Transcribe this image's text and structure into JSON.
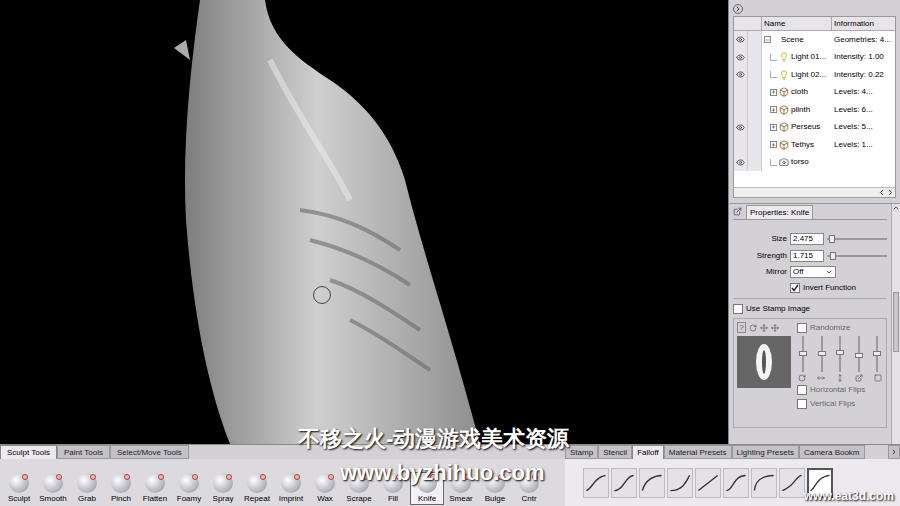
{
  "watermarks": {
    "site_title": "不移之火-动漫游戏美术资源",
    "site_url": "www.byzhihuo.com",
    "source": "www.eat3d.com"
  },
  "viewport": {
    "brush_cursor": true
  },
  "outliner": {
    "columns": [
      "Name",
      "Information"
    ],
    "rows": [
      {
        "name": "Scene",
        "info": "Geometries: 4...",
        "depth": 0,
        "kind": "scene",
        "expandable": true,
        "expanded": true,
        "visible": true,
        "locked": false
      },
      {
        "name": "Light 01...",
        "info": "Intensity: 1.00",
        "depth": 1,
        "kind": "light",
        "expandable": false,
        "expanded": false,
        "visible": true,
        "locked": false
      },
      {
        "name": "Light 02...",
        "info": "Intensity: 0.22",
        "depth": 1,
        "kind": "light",
        "expandable": false,
        "expanded": false,
        "visible": true,
        "locked": false
      },
      {
        "name": "cloth",
        "info": "Levels: 4...",
        "depth": 1,
        "kind": "mesh",
        "expandable": true,
        "expanded": false,
        "visible": false,
        "locked": false
      },
      {
        "name": "plinth",
        "info": "Levels: 6...",
        "depth": 1,
        "kind": "mesh",
        "expandable": true,
        "expanded": false,
        "visible": false,
        "locked": false
      },
      {
        "name": "Perseus",
        "info": "Levels: 5...",
        "depth": 1,
        "kind": "mesh",
        "expandable": true,
        "expanded": false,
        "visible": true,
        "locked": false
      },
      {
        "name": "Tethys",
        "info": "Levels: 1...",
        "depth": 1,
        "kind": "mesh",
        "expandable": true,
        "expanded": false,
        "visible": false,
        "locked": false
      },
      {
        "name": "torso",
        "info": "",
        "depth": 1,
        "kind": "camera",
        "expandable": false,
        "expanded": false,
        "visible": true,
        "locked": false
      }
    ]
  },
  "properties": {
    "title": "Properties: Knife",
    "fields": [
      {
        "label": "Size",
        "value": "2.475",
        "level": 0.03
      },
      {
        "label": "Strength",
        "value": "1.715",
        "level": 0.05
      }
    ],
    "mirror": {
      "label": "Mirror",
      "value": "Off"
    },
    "invert": {
      "label": "Invert Function",
      "checked": true
    },
    "use_stamp": {
      "label": "Use Stamp Image",
      "checked": false
    },
    "stamp": {
      "help": "?",
      "randomize": {
        "label": "Randomize",
        "checked": false
      },
      "sliders": [
        {
          "level": 0.5
        },
        {
          "level": 0.5
        },
        {
          "level": 0.55
        },
        {
          "level": 0.45
        },
        {
          "level": 0.5
        }
      ],
      "horizontal": {
        "label": "Horizontal Flips",
        "checked": false
      },
      "vertical": {
        "label": "Vertical Flips",
        "checked": false
      }
    }
  },
  "tool_tabs": [
    {
      "label": "Sculpt Tools",
      "selected": true
    },
    {
      "label": "Paint Tools",
      "selected": false
    },
    {
      "label": "Select/Move Tools",
      "selected": false
    }
  ],
  "tools": [
    {
      "label": "Sculpt",
      "selected": false
    },
    {
      "label": "Smooth",
      "selected": false
    },
    {
      "label": "Grab",
      "selected": false
    },
    {
      "label": "Pinch",
      "selected": false
    },
    {
      "label": "Flatten",
      "selected": false
    },
    {
      "label": "Foamy",
      "selected": false
    },
    {
      "label": "Spray",
      "selected": false
    },
    {
      "label": "Repeat",
      "selected": false
    },
    {
      "label": "Imprint",
      "selected": false
    },
    {
      "label": "Wax",
      "selected": false
    },
    {
      "label": "Scrape",
      "selected": false
    },
    {
      "label": "Fill",
      "selected": false
    },
    {
      "label": "Knife",
      "selected": true
    },
    {
      "label": "Smear",
      "selected": false
    },
    {
      "label": "Bulge",
      "selected": false
    },
    {
      "label": "Cntr",
      "selected": false
    }
  ],
  "tray_tabs": [
    {
      "label": "Stamp",
      "selected": false
    },
    {
      "label": "Stencil",
      "selected": false
    },
    {
      "label": "Falloff",
      "selected": true
    },
    {
      "label": "Material Presets",
      "selected": false
    },
    {
      "label": "Lighting Presets",
      "selected": false
    },
    {
      "label": "Camera Bookm",
      "selected": false
    }
  ],
  "falloffs": [
    {
      "selected": false
    },
    {
      "selected": false
    },
    {
      "selected": false
    },
    {
      "selected": false
    },
    {
      "selected": false
    },
    {
      "selected": false
    },
    {
      "selected": false
    },
    {
      "selected": false
    },
    {
      "selected": true
    }
  ]
}
